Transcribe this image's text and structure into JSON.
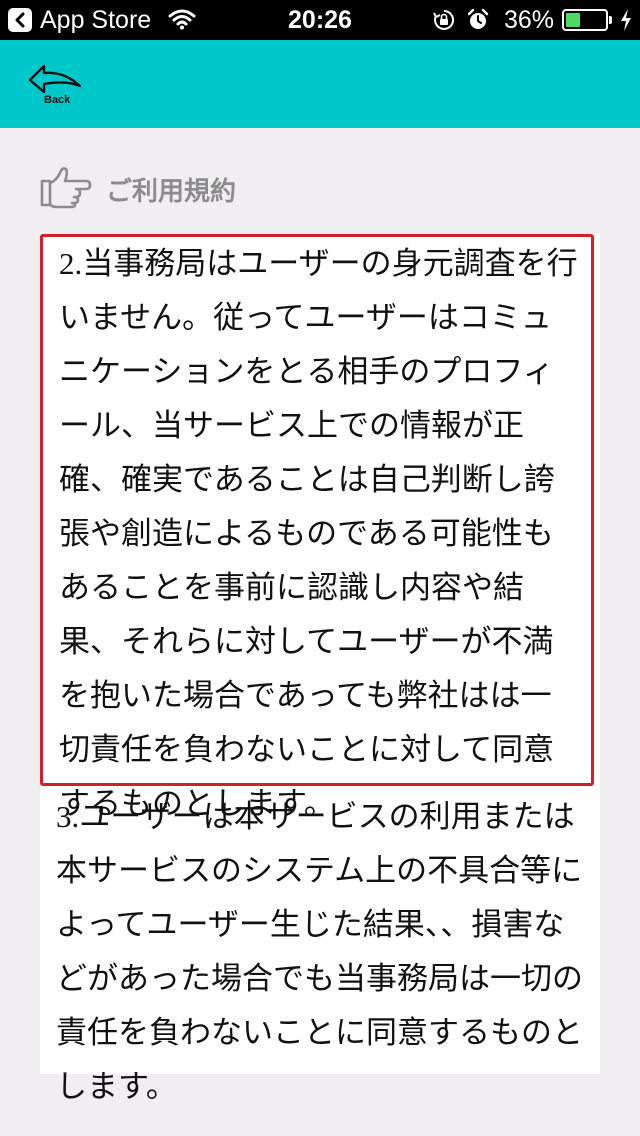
{
  "status_bar": {
    "back_app": "App Store",
    "time": "20:26",
    "battery_percent": "36%",
    "battery_level": 0.36,
    "icons": [
      "back-chevron-icon",
      "wifi-icon",
      "orientation-lock-icon",
      "alarm-icon",
      "battery-icon",
      "charging-bolt-icon"
    ]
  },
  "nav": {
    "back_label": "Back",
    "background_color": "#00c7c9"
  },
  "section": {
    "icon": "pointing-hand-icon",
    "title": "ご利用規約"
  },
  "terms": {
    "clause_2": {
      "number": "2.",
      "text": "当事務局はユーザーの身元調査を行いません。従ってユーザーはコミュニケーションをとる相手のプロフィール、当サービス上での情報が正確、確実であることは自己判断し誇張や創造によるものである可能性もあることを事前に認識し内容や結果、それらに対してユーザーが不満を抱いた場合であっても弊社はは一切責任を負わないことに対して同意するものとします。",
      "highlight_color": "#d0202a"
    },
    "clause_3": {
      "number": "3.",
      "text": "ユーザーは本サービスの利用または本サービスのシステム上の不具合等によってユーザー生じた結果、、損害などがあった場合でも当事務局は一切の責任を負わないことに同意するものとします。"
    }
  }
}
